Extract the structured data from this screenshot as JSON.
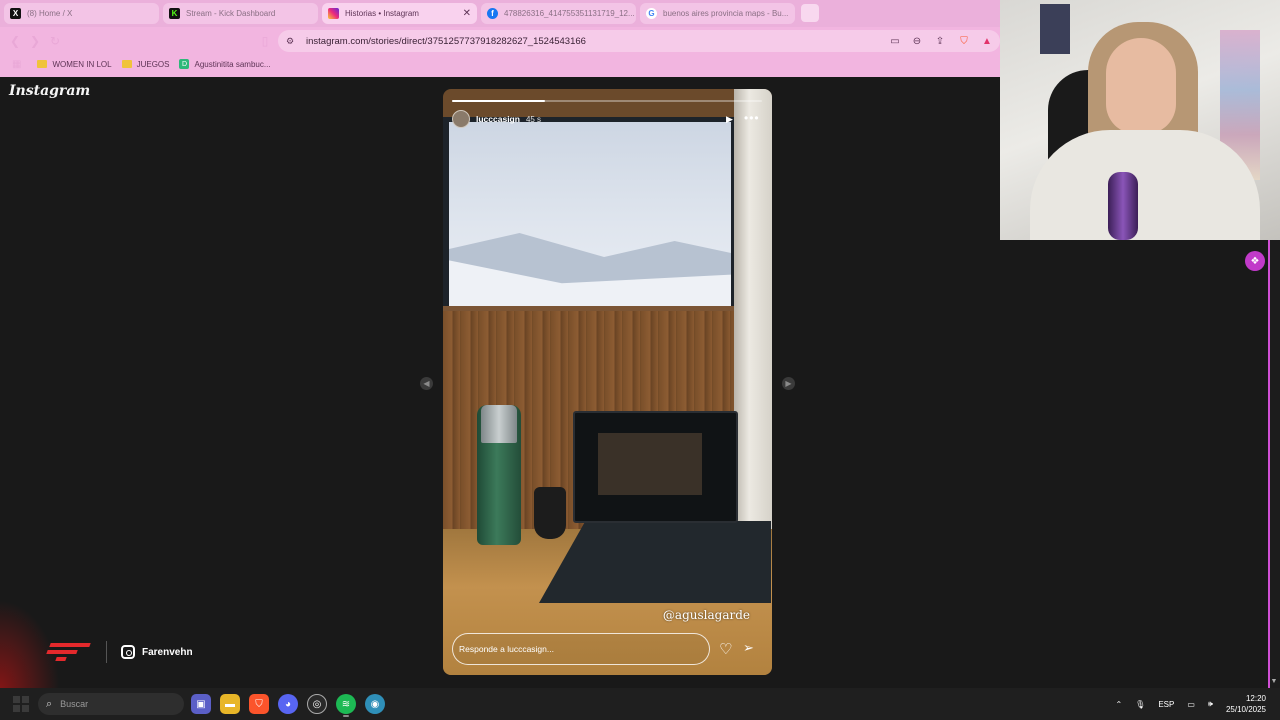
{
  "browser": {
    "tabs": [
      {
        "title": "(8) Home / X",
        "favicon": "x-logo-icon",
        "active": false
      },
      {
        "title": "Stream - Kick Dashboard",
        "favicon": "kick-logo-icon",
        "active": false
      },
      {
        "title": "Historias • Instagram",
        "favicon": "instagram-logo-icon",
        "active": true,
        "close": "✕"
      },
      {
        "title": "478826316_414755351131719_12...",
        "favicon": "facebook-logo-icon",
        "active": false
      },
      {
        "title": "buenos aires provincia maps - Bu...",
        "favicon": "google-logo-icon",
        "active": false
      }
    ],
    "url": "instagram.com/stories/direct/3751257737918282627_1524543166",
    "bookmarks": [
      {
        "label": "WOMEN IN LOL",
        "icon": "folder-icon"
      },
      {
        "label": "JUEGOS",
        "icon": "folder-icon"
      },
      {
        "label": "Agustinitita sambuc...",
        "icon": "d-logo-icon"
      }
    ],
    "colors": {
      "chrome": "#f2b5e0",
      "accent": "#5d3355"
    }
  },
  "instagram": {
    "logo_text": "Instagram",
    "story": {
      "username": "lucccasign",
      "time_ago": "45 s",
      "progress": 0.3,
      "mention": "@aguslagarde",
      "reply_placeholder": "Responde a lucccasign..."
    }
  },
  "overlay": {
    "instagram_handle": "Farenvehn",
    "brand_color": "#e4292c"
  },
  "taskbar": {
    "search_placeholder": "Buscar",
    "apps": [
      "video-call-icon",
      "file-explorer-icon",
      "brave-icon",
      "discord-icon",
      "obs-icon",
      "spotify-icon",
      "browser-icon"
    ],
    "language": "ESP",
    "time": "12:20",
    "date": "25/10/2025"
  }
}
